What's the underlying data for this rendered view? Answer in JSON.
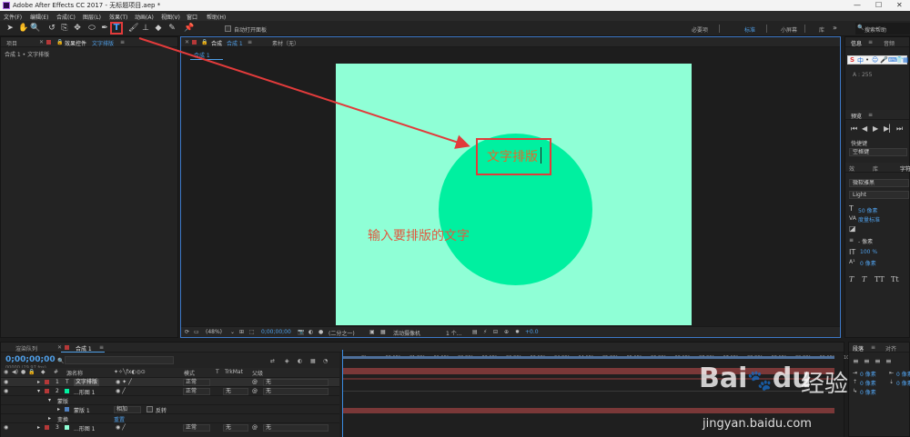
{
  "window": {
    "title": "Adobe After Effects CC 2017 - 无标题项目.aep *",
    "controls": [
      "—",
      "☐",
      "✕"
    ]
  },
  "menu": [
    "文件(F)",
    "编辑(E)",
    "合成(C)",
    "图层(L)",
    "效果(T)",
    "动画(A)",
    "视图(V)",
    "窗口",
    "帮助(H)"
  ],
  "toolbar": {
    "auto_open_label": "自动打开面板",
    "workspaces": [
      "必要项",
      "标准",
      "小屏幕",
      "库"
    ],
    "active_workspace": "标准",
    "search_placeholder": "搜索帮助"
  },
  "project_panel": {
    "tab_project": "项目",
    "tab_effects": "效果控件",
    "effects_target": "文字排版",
    "breadcrumb": "合成 1 • 文字排版"
  },
  "composition_panel": {
    "tab_comp": "合成",
    "comp_name": "合成 1",
    "tab_footage": "素材（无）",
    "sub_tab": "合成 1",
    "layer_text": "文字排版",
    "annotation": "输入要排版的文字",
    "canvas_color": "#8fffd6",
    "circle_color": "#00f0a0",
    "footer": {
      "zoom": "(48%)",
      "timecode": "0;00;00;00",
      "resolution": "(二分之一)",
      "camera": "活动摄像机",
      "views": "1 个...",
      "exposure": "+0.0"
    }
  },
  "info_panel": {
    "tab_info": "信息",
    "tab_audio": "音频",
    "readout_label": "A : 255",
    "tab_preview": "预览",
    "shortcut_label": "快捷键",
    "shortcut_value": "空格键",
    "tab_effects": "效",
    "tab_lib": "库",
    "tab_char": "字符",
    "font_family": "微软雅黑",
    "font_style": "Light",
    "font_size": "50 像素",
    "kerning": "度量标准",
    "tracking": "- 像素",
    "vertical_scale": "100 %",
    "baseline": "0 像素",
    "ime": [
      "中",
      "•",
      "☺",
      "🎤",
      "⌨",
      "👕",
      "▦"
    ]
  },
  "timeline": {
    "tab_render": "渲染队列",
    "tab_comp": "合成 1",
    "timecode": "0;00;00;00",
    "fps": "00000 (29.97 fps)",
    "search_placeholder": "",
    "columns": [
      "源名称",
      "模式",
      "T",
      "TrkMat",
      "父级"
    ],
    "layers": [
      {
        "num": "1",
        "type": "T",
        "name": "文字排版",
        "mode": "正常",
        "trk": "",
        "parent": "无",
        "color": "#b53838",
        "selected": true
      },
      {
        "num": "2",
        "type": "",
        "name": "...形图 1",
        "mode": "正常",
        "trk": "无",
        "parent": "无",
        "color": "#b53838",
        "selected": false
      },
      {
        "num": "3",
        "type": "",
        "name": "...形图 1",
        "mode": "正常",
        "trk": "无",
        "parent": "无",
        "color": "#b53838",
        "selected": false
      }
    ],
    "sub_rows": [
      {
        "label": "蒙版"
      },
      {
        "label": "蒙版 1",
        "mode": "相加",
        "invert": "反转"
      },
      {
        "label": "变换",
        "value": "重置"
      }
    ],
    "ruler": [
      "0f",
      "00:15f",
      "01:00f",
      "01:15f",
      "02:00f",
      "02:15f",
      "03:00f",
      "03:15f",
      "04:00f",
      "04:15f",
      "05:00f",
      "05:15f",
      "06:00f",
      "06:15f",
      "07:00f",
      "07:15f",
      "08:00f",
      "08:15f",
      "09:00f",
      "09:15f",
      "10:0"
    ]
  },
  "paragraph_panel": {
    "tab_para": "段落",
    "tab_align": "对齐",
    "values": [
      "0 像素",
      "0 像素",
      "0 像素",
      "0 像素",
      "0 像素"
    ]
  },
  "watermark": {
    "logo": "Bai",
    "logo_tail": "du",
    "cn": "经验",
    "url": "jingyan.baidu.com"
  }
}
